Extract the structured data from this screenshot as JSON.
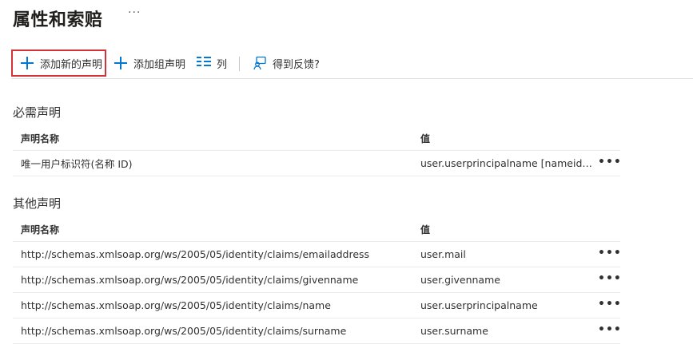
{
  "header": {
    "title": "属性和索赔",
    "more": "···"
  },
  "toolbar": {
    "add_claim": "添加新的声明",
    "add_group_claim": "添加组声明",
    "columns": "列",
    "feedback": "得到反馈?"
  },
  "required": {
    "title": "必需声明",
    "col_name": "声明名称",
    "col_value": "值",
    "rows": [
      {
        "name": "唯一用户标识符(名称 ID)",
        "value": "user.userprincipalname [nameid-for..."
      }
    ]
  },
  "other": {
    "title": "其他声明",
    "col_name": "声明名称",
    "col_value": "值",
    "rows": [
      {
        "name": "http://schemas.xmlsoap.org/ws/2005/05/identity/claims/emailaddress",
        "value": "user.mail"
      },
      {
        "name": "http://schemas.xmlsoap.org/ws/2005/05/identity/claims/givenname",
        "value": "user.givenname"
      },
      {
        "name": "http://schemas.xmlsoap.org/ws/2005/05/identity/claims/name",
        "value": "user.userprincipalname"
      },
      {
        "name": "http://schemas.xmlsoap.org/ws/2005/05/identity/claims/surname",
        "value": "user.surname"
      }
    ]
  },
  "row_more": "•••",
  "colors": {
    "accent": "#0078d4",
    "highlight_border": "#d13438",
    "divider": "#edebe9"
  },
  "icons": {
    "add": "plus-icon",
    "columns": "columns-icon",
    "feedback": "feedback-icon",
    "more": "more-icon"
  }
}
